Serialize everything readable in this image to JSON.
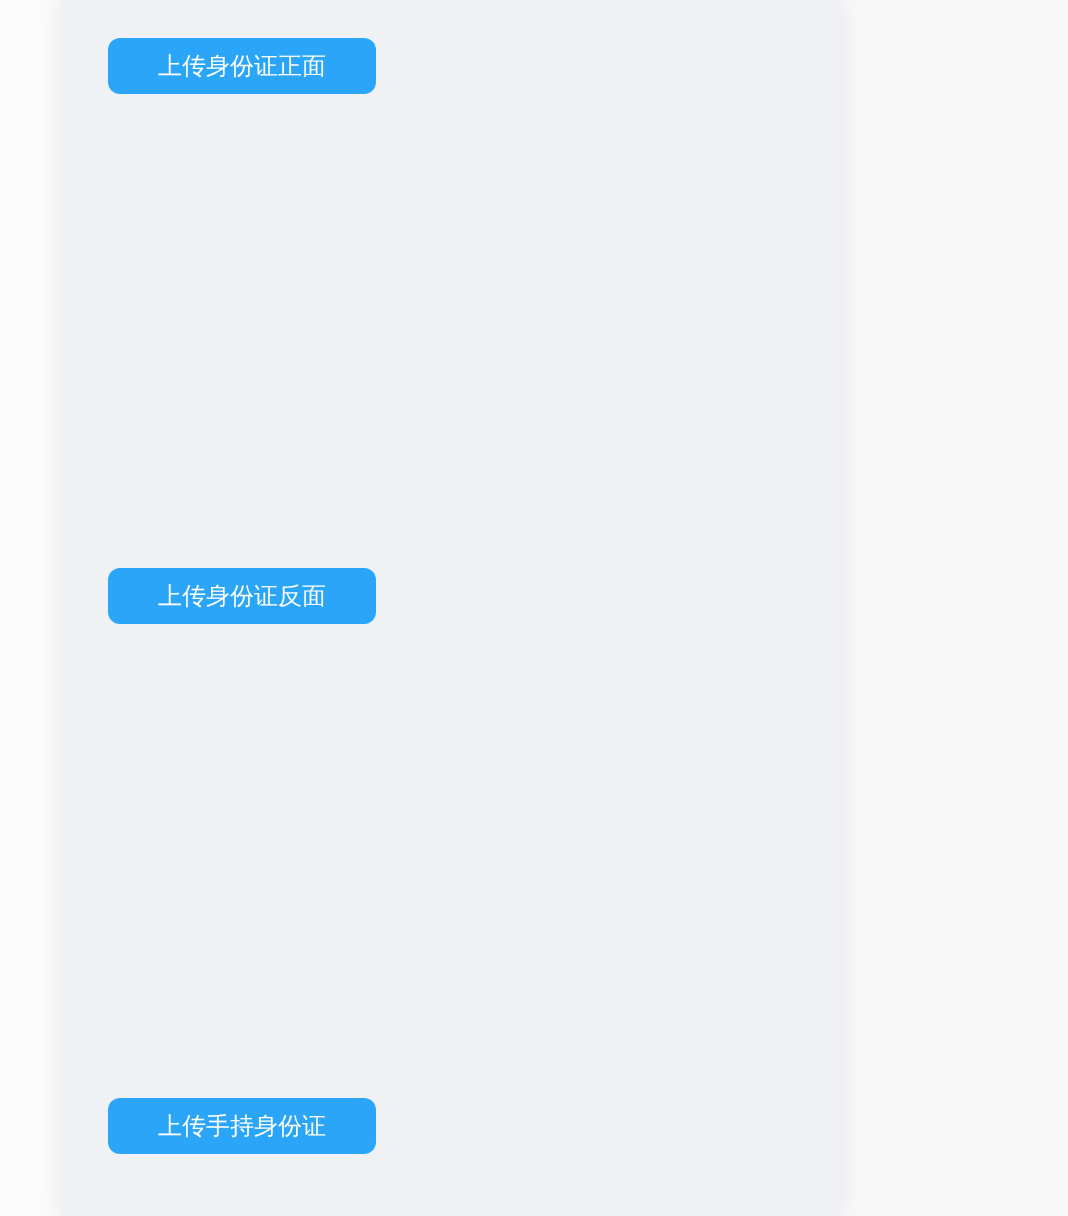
{
  "upload_buttons": [
    {
      "label": "上传身份证正面"
    },
    {
      "label": "上传身份证反面"
    },
    {
      "label": "上传手持身份证"
    }
  ]
}
